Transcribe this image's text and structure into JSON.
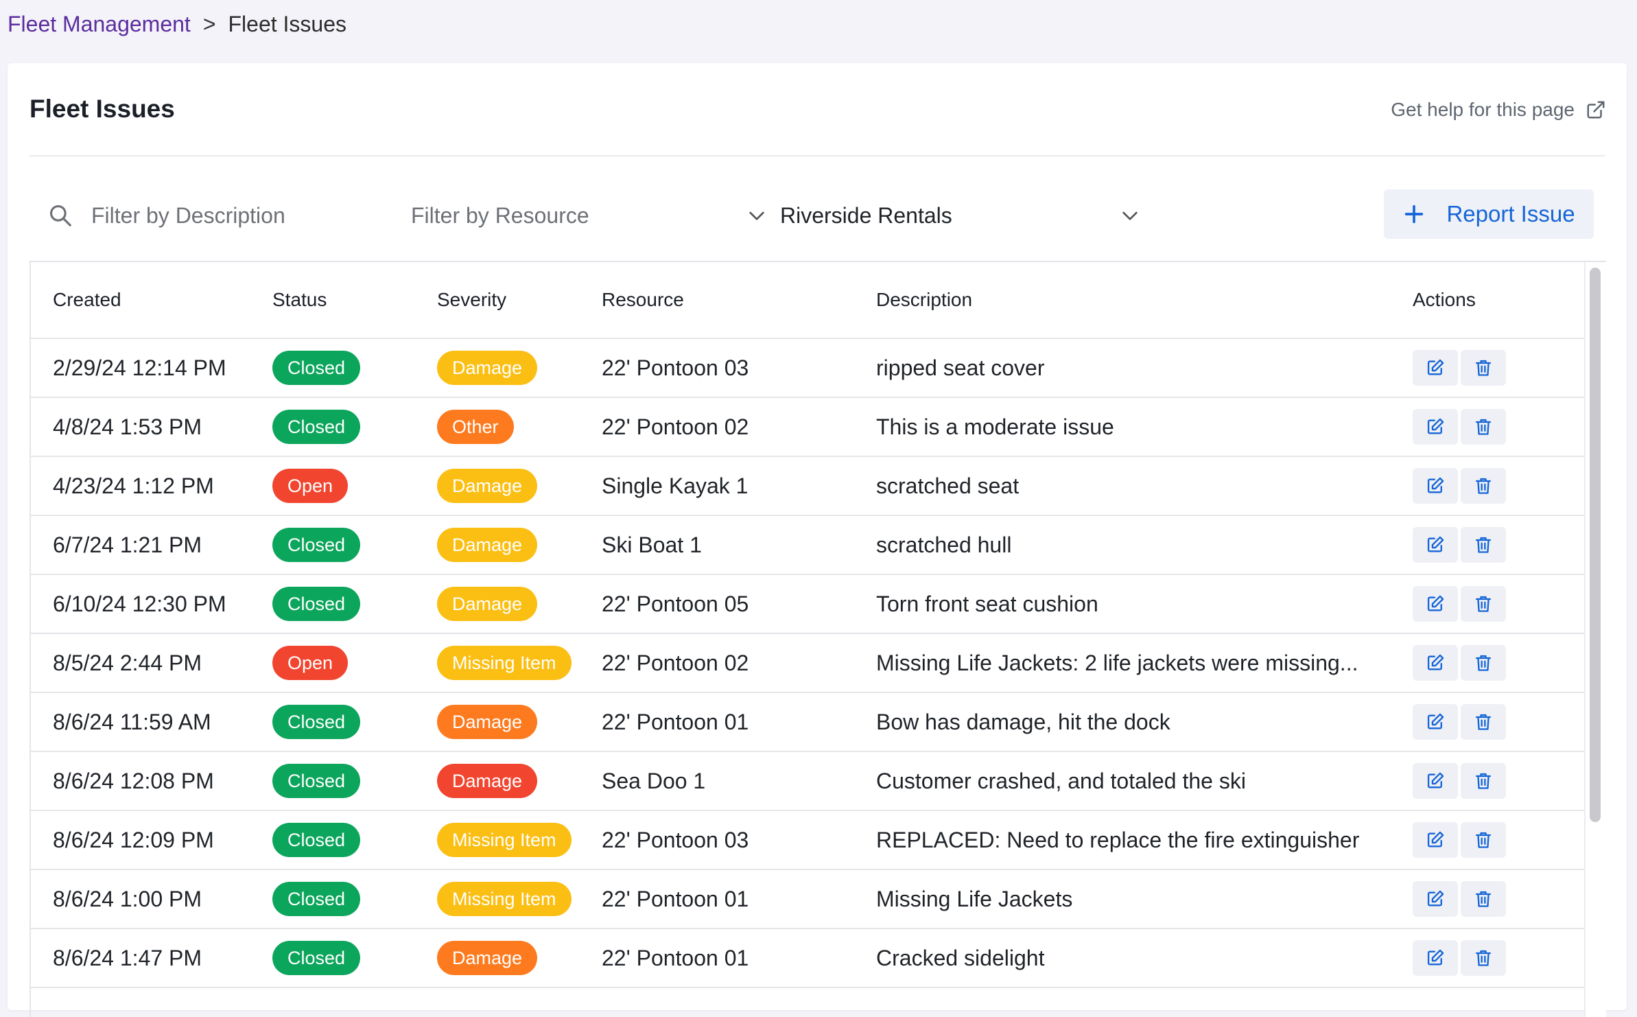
{
  "breadcrumb": {
    "parent": "Fleet Management",
    "separator": ">",
    "current": "Fleet Issues"
  },
  "header": {
    "title": "Fleet Issues",
    "help_label": "Get help for this page"
  },
  "filters": {
    "description_placeholder": "Filter by Description",
    "resource_placeholder": "Filter by Resource",
    "location_selected": "Riverside Rentals"
  },
  "report_button_label": "Report Issue",
  "colors": {
    "status_closed": "#0ca55c",
    "status_open": "#f1452f",
    "severity_yellow": "#fbbe12",
    "severity_orange": "#fd7a1e",
    "severity_red": "#f1452f",
    "accent_blue": "#1565d8"
  },
  "table": {
    "headers": [
      "Created",
      "Status",
      "Severity",
      "Resource",
      "Description",
      "Actions"
    ],
    "rows": [
      {
        "created": "2/29/24 12:14 PM",
        "status": "Closed",
        "severity": "Damage",
        "severity_color": "#fbbe12",
        "resource": "22' Pontoon 03",
        "description": "ripped seat cover"
      },
      {
        "created": "4/8/24 1:53 PM",
        "status": "Closed",
        "severity": "Other",
        "severity_color": "#fd7a1e",
        "resource": "22' Pontoon 02",
        "description": "This is a moderate issue"
      },
      {
        "created": "4/23/24 1:12 PM",
        "status": "Open",
        "severity": "Damage",
        "severity_color": "#fbbe12",
        "resource": "Single Kayak 1",
        "description": "scratched seat"
      },
      {
        "created": "6/7/24 1:21 PM",
        "status": "Closed",
        "severity": "Damage",
        "severity_color": "#fbbe12",
        "resource": "Ski Boat 1",
        "description": "scratched hull"
      },
      {
        "created": "6/10/24 12:30 PM",
        "status": "Closed",
        "severity": "Damage",
        "severity_color": "#fbbe12",
        "resource": "22' Pontoon 05",
        "description": "Torn front seat cushion"
      },
      {
        "created": "8/5/24 2:44 PM",
        "status": "Open",
        "severity": "Missing Item",
        "severity_color": "#fbbe12",
        "resource": "22' Pontoon 02",
        "description": "Missing Life Jackets: 2 life jackets were missing..."
      },
      {
        "created": "8/6/24 11:59 AM",
        "status": "Closed",
        "severity": "Damage",
        "severity_color": "#fd7a1e",
        "resource": "22' Pontoon 01",
        "description": "Bow has damage, hit the dock"
      },
      {
        "created": "8/6/24 12:08 PM",
        "status": "Closed",
        "severity": "Damage",
        "severity_color": "#f1452f",
        "resource": "Sea Doo 1",
        "description": "Customer crashed, and totaled the ski"
      },
      {
        "created": "8/6/24 12:09 PM",
        "status": "Closed",
        "severity": "Missing Item",
        "severity_color": "#fbbe12",
        "resource": "22' Pontoon 03",
        "description": "REPLACED: Need to replace the fire extinguisher"
      },
      {
        "created": "8/6/24 1:00 PM",
        "status": "Closed",
        "severity": "Missing Item",
        "severity_color": "#fbbe12",
        "resource": "22' Pontoon 01",
        "description": "Missing Life Jackets"
      },
      {
        "created": "8/6/24 1:47 PM",
        "status": "Closed",
        "severity": "Damage",
        "severity_color": "#fd7a1e",
        "resource": "22' Pontoon 01",
        "description": "Cracked sidelight"
      }
    ]
  },
  "icons": {
    "search": "search-icon",
    "chevron": "chevron-down-icon",
    "external_link": "external-link-icon",
    "plus": "plus-icon",
    "edit": "edit-icon",
    "delete": "trash-icon"
  }
}
